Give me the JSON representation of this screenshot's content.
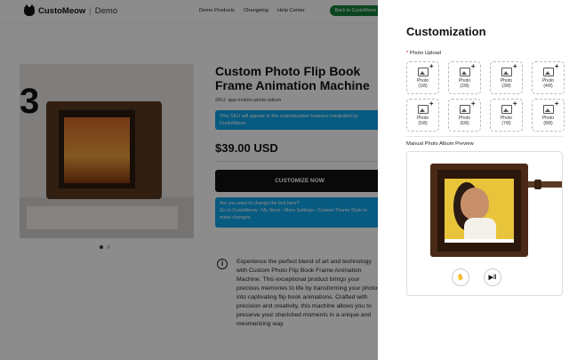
{
  "header": {
    "brand": "CustoMeow",
    "brand_suffix": "Demo",
    "nav": [
      "Demo Products",
      "Changelog",
      "Help Center"
    ],
    "back_label": "Back to CustoMeow"
  },
  "product": {
    "gallery_number": "3",
    "title": "Custom Photo Flip Book Frame Animation Machine",
    "sku": "SKU: app-motion-photo-album",
    "note": "This SKU will appear in the customization features integrated by CustoMeow.",
    "price": "$39.00 USD",
    "customize_label": "CUSTOMIZE NOW",
    "note2_line1": "Are you want to change the text here?",
    "note2_line2": "Go to CustoMeow › My Store › More Settings › Custom Theme Style to make changes.",
    "description": "Experience the perfect blend of art and technology with Custom Photo Flip Book Frame Animation Machine. This exceptional product brings your precious memories to life by transforming your photos into captivating flip book animations. Crafted with precision and creativity, this machine allows you to preserve your cherished moments in a unique and mesmerizing way."
  },
  "panel": {
    "title": "Customization",
    "upload_required": "*",
    "upload_label": "Photo Upload",
    "slots": [
      {
        "label": "Photo",
        "index": "(1/8)"
      },
      {
        "label": "Photo",
        "index": "(2/8)"
      },
      {
        "label": "Photo",
        "index": "(3/8)"
      },
      {
        "label": "Photo",
        "index": "(4/8)"
      },
      {
        "label": "Photo",
        "index": "(5/8)"
      },
      {
        "label": "Photo",
        "index": "(6/8)"
      },
      {
        "label": "Photo",
        "index": "(7/8)"
      },
      {
        "label": "Photo",
        "index": "(8/8)"
      }
    ],
    "preview_label": "Manual Photo Album Preview",
    "hand_icon": "hand-crank-icon",
    "play_icon": "play-pause-icon",
    "play_glyph": "▶‖",
    "hand_glyph": "✋"
  }
}
